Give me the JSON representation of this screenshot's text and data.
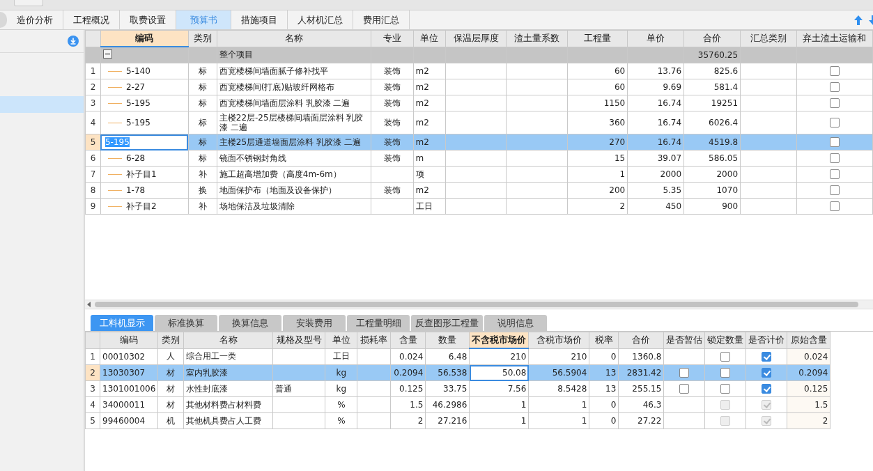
{
  "tabs": [
    {
      "label": "造价分析",
      "selected": false
    },
    {
      "label": "工程概况",
      "selected": false
    },
    {
      "label": "取费设置",
      "selected": false
    },
    {
      "label": "预算书",
      "selected": true
    },
    {
      "label": "措施项目",
      "selected": false
    },
    {
      "label": "人材机汇总",
      "selected": false
    },
    {
      "label": "费用汇总",
      "selected": false
    }
  ],
  "main_table": {
    "columns": [
      {
        "label": "编码",
        "highlighted": true
      },
      {
        "label": "类别",
        "highlighted": false
      },
      {
        "label": "名称",
        "highlighted": false
      },
      {
        "label": "专业",
        "highlighted": false
      },
      {
        "label": "单位",
        "highlighted": false
      },
      {
        "label": "保温层厚度",
        "highlighted": false
      },
      {
        "label": "渣土量系数",
        "highlighted": false
      },
      {
        "label": "工程量",
        "highlighted": false
      },
      {
        "label": "单价",
        "highlighted": false
      },
      {
        "label": "合价",
        "highlighted": false
      },
      {
        "label": "汇总类别",
        "highlighted": false
      },
      {
        "label": "弃土渣土运输和",
        "highlighted": false
      }
    ],
    "group": {
      "label": "整个项目",
      "total": "35760.25",
      "expanded": true
    },
    "rows": [
      {
        "num": "1",
        "code": "5-140",
        "type": "标",
        "name": "西宽楼梯间墙面腻子修补找平",
        "specialty": "装饰",
        "unit": "m2",
        "quantity": "60",
        "unit_price": "13.76",
        "total": "825.6",
        "checked": false,
        "selected": false
      },
      {
        "num": "2",
        "code": "2-27",
        "type": "标",
        "name": "西宽楼梯间(打底)贴玻纤网格布",
        "specialty": "装饰",
        "unit": "m2",
        "quantity": "60",
        "unit_price": "9.69",
        "total": "581.4",
        "checked": false,
        "selected": false
      },
      {
        "num": "3",
        "code": "5-195",
        "type": "标",
        "name": "西宽楼梯间墙面层涂料 乳胶漆 二遍",
        "specialty": "装饰",
        "unit": "m2",
        "quantity": "1150",
        "unit_price": "16.74",
        "total": "19251",
        "checked": false,
        "selected": false
      },
      {
        "num": "4",
        "code": "5-195",
        "type": "标",
        "name": "主楼22层-25层楼梯间墙面层涂料 乳胶漆 二遍",
        "specialty": "装饰",
        "unit": "m2",
        "quantity": "360",
        "unit_price": "16.74",
        "total": "6026.4",
        "checked": false,
        "selected": false
      },
      {
        "num": "5",
        "code": "5-195",
        "type": "标",
        "name": "主楼25层通道墙面层涂料 乳胶漆 二遍",
        "specialty": "装饰",
        "unit": "m2",
        "quantity": "270",
        "unit_price": "16.74",
        "total": "4519.8",
        "checked": false,
        "selected": true
      },
      {
        "num": "6",
        "code": "6-28",
        "type": "标",
        "name": "镜面不锈钢封角线",
        "specialty": "装饰",
        "unit": "m",
        "quantity": "15",
        "unit_price": "39.07",
        "total": "586.05",
        "checked": false,
        "selected": false
      },
      {
        "num": "7",
        "code": "补子目1",
        "type": "补",
        "name": "施工超高增加费（高度4m-6m）",
        "unit": "项",
        "quantity": "1",
        "unit_price": "2000",
        "total": "2000",
        "checked": false,
        "selected": false
      },
      {
        "num": "8",
        "code": "1-78",
        "type": "换",
        "name": "地面保护布（地面及设备保护）",
        "specialty": "装饰",
        "unit": "m2",
        "quantity": "200",
        "unit_price": "5.35",
        "total": "1070",
        "checked": false,
        "selected": false
      },
      {
        "num": "9",
        "code": "补子目2",
        "type": "补",
        "name": "场地保洁及垃圾清除",
        "unit": "工日",
        "quantity": "2",
        "unit_price": "450",
        "total": "900",
        "checked": false,
        "selected": false
      }
    ]
  },
  "detail_tabs": [
    {
      "label": "工料机显示",
      "selected": true
    },
    {
      "label": "标准换算",
      "selected": false
    },
    {
      "label": "换算信息",
      "selected": false
    },
    {
      "label": "安装费用",
      "selected": false
    },
    {
      "label": "工程量明细",
      "selected": false
    },
    {
      "label": "反查图形工程量",
      "selected": false
    },
    {
      "label": "说明信息",
      "selected": false
    }
  ],
  "detail_table": {
    "columns": [
      {
        "label": "编码",
        "highlighted": false
      },
      {
        "label": "类别",
        "highlighted": false
      },
      {
        "label": "名称",
        "highlighted": false
      },
      {
        "label": "规格及型号",
        "highlighted": false
      },
      {
        "label": "单位",
        "highlighted": false
      },
      {
        "label": "损耗率",
        "highlighted": false
      },
      {
        "label": "含量",
        "highlighted": false
      },
      {
        "label": "数量",
        "highlighted": false
      },
      {
        "label": "不含税市场价",
        "highlighted": true
      },
      {
        "label": "含税市场价",
        "highlighted": false
      },
      {
        "label": "税率",
        "highlighted": false
      },
      {
        "label": "合价",
        "highlighted": false
      },
      {
        "label": "是否暂估",
        "highlighted": false
      },
      {
        "label": "锁定数量",
        "highlighted": false
      },
      {
        "label": "是否计价",
        "highlighted": false
      },
      {
        "label": "原始含量",
        "highlighted": false
      }
    ],
    "rows": [
      {
        "num": "1",
        "code": "00010302",
        "type": "人",
        "name": "综合用工一类",
        "unit": "工日",
        "content": "0.024",
        "quantity": "6.48",
        "price_ex_tax": "210",
        "price_inc_tax": "210",
        "tax_rate": "0",
        "total": "1360.8",
        "lock": {
          "checked": false,
          "disabled": false
        },
        "priced": {
          "checked": true,
          "disabled": false
        },
        "original_content": "0.024",
        "selected": false
      },
      {
        "num": "2",
        "code": "13030307",
        "type": "材",
        "name": "室内乳胶漆",
        "unit": "kg",
        "content": "0.2094",
        "quantity": "56.538",
        "price_ex_tax": "50.08",
        "price_inc_tax": "56.5904",
        "tax_rate": "13",
        "total": "2831.42",
        "provisional": {
          "checked": false
        },
        "lock": {
          "checked": false,
          "disabled": false
        },
        "priced": {
          "checked": true,
          "disabled": false
        },
        "original_content": "0.2094",
        "selected": true
      },
      {
        "num": "3",
        "code": "1301001006",
        "type": "材",
        "name": "水性封底漆",
        "spec": "普通",
        "unit": "kg",
        "content": "0.125",
        "quantity": "33.75",
        "price_ex_tax": "7.56",
        "price_inc_tax": "8.5428",
        "tax_rate": "13",
        "total": "255.15",
        "provisional": {
          "checked": false
        },
        "lock": {
          "checked": false,
          "disabled": false
        },
        "priced": {
          "checked": true,
          "disabled": false
        },
        "original_content": "0.125",
        "selected": false
      },
      {
        "num": "4",
        "code": "34000011",
        "type": "材",
        "name": "其他材料费占材料费",
        "unit": "%",
        "content": "1.5",
        "quantity": "46.2986",
        "price_ex_tax": "1",
        "price_inc_tax": "1",
        "tax_rate": "0",
        "total": "46.3",
        "lock": {
          "checked": false,
          "disabled": true
        },
        "priced": {
          "checked": true,
          "disabled": true
        },
        "original_content": "1.5",
        "selected": false
      },
      {
        "num": "5",
        "code": "99460004",
        "type": "机",
        "name": "其他机具费占人工费",
        "unit": "%",
        "content": "2",
        "quantity": "27.216",
        "price_ex_tax": "1",
        "price_inc_tax": "1",
        "tax_rate": "0",
        "total": "27.22",
        "lock": {
          "checked": false,
          "disabled": true
        },
        "priced": {
          "checked": true,
          "disabled": true
        },
        "original_content": "2",
        "selected": false
      }
    ]
  }
}
